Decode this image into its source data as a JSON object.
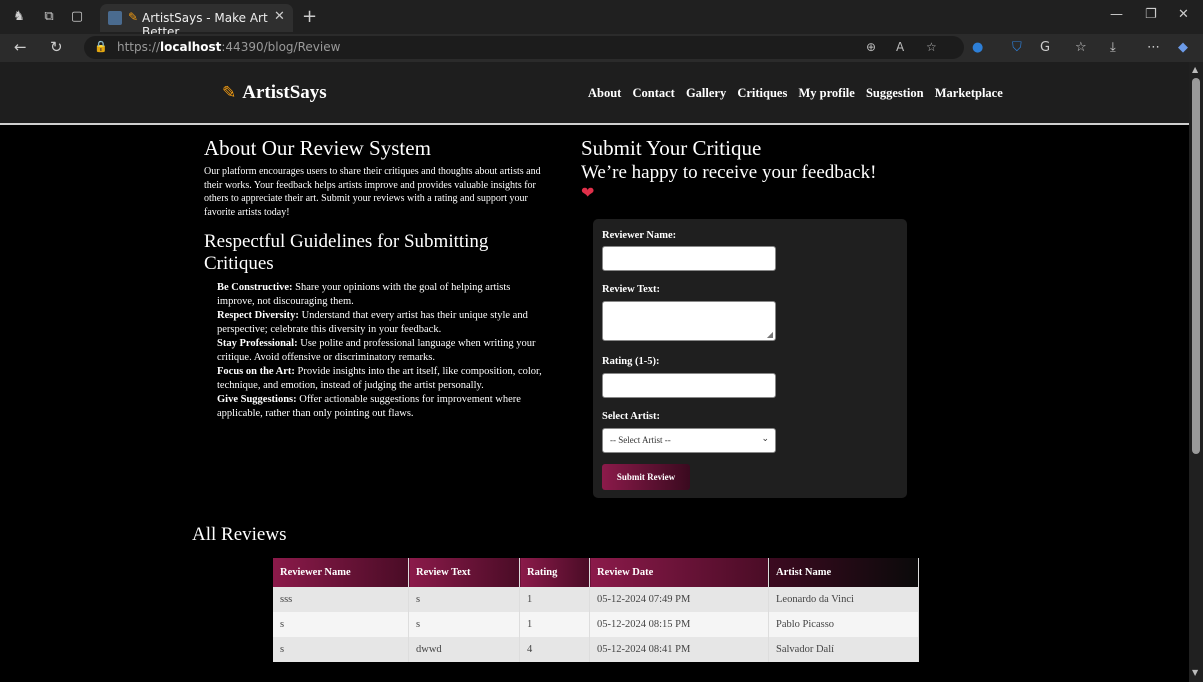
{
  "browser": {
    "tab_title": "ArtistSays - Make Art Better",
    "url_prefix": "https://",
    "url_host": "localhost",
    "url_path": ":44390/blog/Review"
  },
  "site": {
    "brand": "ArtistSays",
    "nav": [
      "About",
      "Contact",
      "Gallery",
      "Critiques",
      "My profile",
      "Suggestion",
      "Marketplace"
    ]
  },
  "about": {
    "title": "About Our Review System",
    "text": "Our platform encourages users to share their critiques and thoughts about artists and their works. Your feedback helps artists improve and provides valuable insights for others to appreciate their art. Submit your reviews with a rating and support your favorite artists today!"
  },
  "guidelines": {
    "title": "Respectful Guidelines for Submitting Critiques",
    "items": [
      {
        "label": "Be Constructive:",
        "text": " Share your opinions with the goal of helping artists improve, not discouraging them."
      },
      {
        "label": "Respect Diversity:",
        "text": " Understand that every artist has their unique style and perspective; celebrate this diversity in your feedback."
      },
      {
        "label": "Stay Professional:",
        "text": " Use polite and professional language when writing your critique. Avoid offensive or discriminatory remarks."
      },
      {
        "label": "Focus on the Art:",
        "text": " Provide insights into the art itself, like composition, color, technique, and emotion, instead of judging the artist personally."
      },
      {
        "label": "Give Suggestions:",
        "text": " Offer actionable suggestions for improvement where applicable, rather than only pointing out flaws."
      }
    ]
  },
  "critique": {
    "title": "Submit Your Critique",
    "subtitle": "We’re happy to receive your feedback!",
    "heart": "❤",
    "form": {
      "reviewer_label": "Reviewer Name:",
      "reviewer_value": "",
      "text_label": "Review Text:",
      "text_value": "",
      "rating_label": "Rating (1-5):",
      "rating_value": "",
      "artist_label": "Select Artist:",
      "artist_selected": "-- Select Artist --",
      "submit": "Submit Review"
    }
  },
  "reviews": {
    "title": "All Reviews",
    "columns": [
      "Reviewer Name",
      "Review Text",
      "Rating",
      "Review Date",
      "Artist Name"
    ],
    "rows": [
      [
        "sss",
        "s",
        "1",
        "05-12-2024 07:49 PM",
        "Leonardo da Vinci"
      ],
      [
        "s",
        "s",
        "1",
        "05-12-2024 08:15 PM",
        "Pablo Picasso"
      ],
      [
        "s",
        "dwwd",
        "4",
        "05-12-2024 08:41 PM",
        "Salvador Dalí"
      ]
    ]
  },
  "colors": {
    "accent": "#8b1a4a",
    "brand_icon": "#f39c12",
    "heart": "#e0304a"
  }
}
